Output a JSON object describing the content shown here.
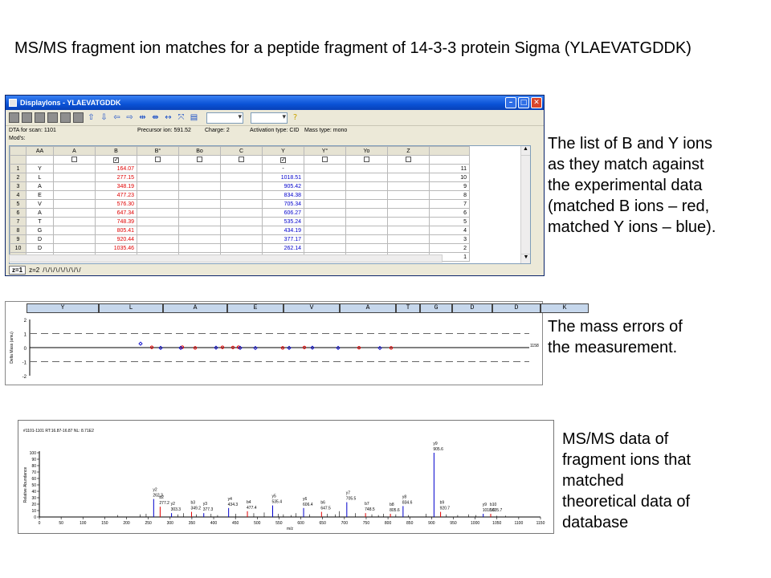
{
  "slide": {
    "title": "MS/MS fragment ion matches for a peptide fragment of 14-3-3 protein Sigma (YLAEVATGDDK)",
    "desc_ions": " The list of B and Y ions\nas they match against\nthe experimental data\n(matched B ions – red,\nmatched Y ions – blue).",
    "desc_errors": "The mass errors of\nthe measurement.",
    "desc_spectrum": "MS/MS data of\nfragment ions that\nmatched\ntheoretical data of\ndatabase"
  },
  "window": {
    "title": "DisplayIons - YLAEVATGDDK",
    "dta": "DTA for scan: 1101",
    "precursor": "Precursor ion: 591.52",
    "charge": "Charge: 2",
    "activation": "Activation type: CID",
    "mass_type": "Mass type: mono",
    "mods": "Mod's:",
    "columns": [
      "AA",
      "A",
      "B",
      "B°",
      "Bo",
      "C",
      "Y",
      "Y°",
      "Yo",
      "Z"
    ],
    "rows": [
      {
        "n": "1",
        "aa": "Y",
        "b": "164.07",
        "y": "-",
        "rn": "11"
      },
      {
        "n": "2",
        "aa": "L",
        "b": "277.15",
        "y": "1018.51",
        "rn": "10"
      },
      {
        "n": "3",
        "aa": "A",
        "b": "348.19",
        "y": "905.42",
        "rn": "9"
      },
      {
        "n": "4",
        "aa": "E",
        "b": "477.23",
        "y": "834.38",
        "rn": "8"
      },
      {
        "n": "5",
        "aa": "V",
        "b": "576.30",
        "y": "705.34",
        "rn": "7"
      },
      {
        "n": "6",
        "aa": "A",
        "b": "647.34",
        "y": "606.27",
        "rn": "6"
      },
      {
        "n": "7",
        "aa": "T",
        "b": "748.39",
        "y": "535.24",
        "rn": "5"
      },
      {
        "n": "8",
        "aa": "G",
        "b": "805.41",
        "y": "434.19",
        "rn": "4"
      },
      {
        "n": "9",
        "aa": "D",
        "b": "920.44",
        "y": "377.17",
        "rn": "3"
      },
      {
        "n": "10",
        "aa": "D",
        "b": "1035.46",
        "y": "262.14",
        "rn": "2"
      },
      {
        "n": "11",
        "aa": "K",
        "b": "-",
        "y": "147.11",
        "rn": "1"
      }
    ],
    "ztab1": "z=1",
    "ztab2": "z=2"
  },
  "chart_data": [
    {
      "type": "scatter",
      "sequence": [
        "Y",
        "L",
        "A",
        "E",
        "V",
        "A",
        "T",
        "G",
        "D",
        "D",
        "K"
      ],
      "ylim": [
        -2,
        2
      ],
      "y_ticks": [
        "2",
        "1",
        "0",
        "-1",
        "-2"
      ],
      "ylabel": "Delta Mass (amu)",
      "b_errors": [
        0.02,
        0.03,
        -0.02,
        0.02,
        0.01,
        0.03,
        -0.02,
        0.01,
        -0.01,
        -0.02
      ],
      "y_errors": [
        0.28,
        -0.02,
        -0.02,
        -0.01,
        -0.02,
        -0.03,
        -0.02,
        -0.01,
        -0.02,
        -0.03
      ],
      "colors": {
        "b": "#e00000",
        "y": "#0000cc"
      },
      "right_label": "1158"
    },
    {
      "type": "bar",
      "header": "#1101-1101 RT:16.87-16.87 NL: 8.71E2",
      "xlabel": "m/z",
      "ylabel": "Relative Abundance",
      "xlim": [
        0,
        1150
      ],
      "ylim": [
        0,
        100
      ],
      "x_ticks": [
        "0",
        "50",
        "100",
        "150",
        "200",
        "250",
        "300",
        "350",
        "400",
        "450",
        "500",
        "550",
        "600",
        "650",
        "700",
        "750",
        "800",
        "850",
        "900",
        "950",
        "1000",
        "1050",
        "1100",
        "1150"
      ],
      "y_ticks": [
        "0",
        "10",
        "20",
        "30",
        "40",
        "50",
        "60",
        "70",
        "80",
        "90",
        "100"
      ],
      "peaks": [
        {
          "mz": 262.3,
          "h": 28,
          "ion": "y2",
          "label": "262.3",
          "s": "y"
        },
        {
          "mz": 277.2,
          "h": 16,
          "ion": "b2",
          "label": "277.2",
          "s": "b"
        },
        {
          "mz": 303.3,
          "h": 6,
          "ion": "y2",
          "label": "303.3",
          "s": "y"
        },
        {
          "mz": 349.2,
          "h": 8,
          "ion": "b3",
          "label": "349.2",
          "s": "b"
        },
        {
          "mz": 377.3,
          "h": 6,
          "ion": "y3",
          "label": "377.3",
          "s": "y"
        },
        {
          "mz": 434.3,
          "h": 14,
          "ion": "y4",
          "label": "434.3",
          "s": "y"
        },
        {
          "mz": 477.4,
          "h": 9,
          "ion": "b4",
          "label": "477.4",
          "s": "b"
        },
        {
          "mz": 535.4,
          "h": 18,
          "ion": "y5",
          "label": "535.4",
          "s": "y"
        },
        {
          "mz": 606.4,
          "h": 14,
          "ion": "y6",
          "label": "606.4",
          "s": "y"
        },
        {
          "mz": 647.5,
          "h": 8,
          "ion": "b6",
          "label": "647.5",
          "s": "b"
        },
        {
          "mz": 705.5,
          "h": 23,
          "ion": "y7",
          "label": "705.5",
          "s": "y"
        },
        {
          "mz": 748.5,
          "h": 6,
          "ion": "b7",
          "label": "748.5",
          "s": "b"
        },
        {
          "mz": 805.6,
          "h": 5,
          "ion": "b8",
          "label": "805.6",
          "s": "b"
        },
        {
          "mz": 834.6,
          "h": 17,
          "ion": "y8",
          "label": "834.6",
          "s": "y"
        },
        {
          "mz": 905.6,
          "h": 100,
          "ion": "y9",
          "label": "905.6",
          "s": "y"
        },
        {
          "mz": 920.7,
          "h": 8,
          "ion": "b9",
          "label": "920.7",
          "s": "b"
        },
        {
          "mz": 1018.6,
          "h": 5,
          "ion": "y9",
          "label": "1018.6",
          "s": "y"
        },
        {
          "mz": 1035.7,
          "h": 5,
          "ion": "b10",
          "label": "1035.7",
          "s": "b"
        }
      ],
      "noise": [
        {
          "mz": 180,
          "h": 3
        },
        {
          "mz": 231,
          "h": 4
        },
        {
          "mz": 245,
          "h": 5
        },
        {
          "mz": 318,
          "h": 4
        },
        {
          "mz": 331,
          "h": 6
        },
        {
          "mz": 360,
          "h": 4
        },
        {
          "mz": 394,
          "h": 5
        },
        {
          "mz": 409,
          "h": 3
        },
        {
          "mz": 451,
          "h": 5
        },
        {
          "mz": 492,
          "h": 6
        },
        {
          "mz": 516,
          "h": 7
        },
        {
          "mz": 548,
          "h": 5
        },
        {
          "mz": 560,
          "h": 4
        },
        {
          "mz": 578,
          "h": 3
        },
        {
          "mz": 589,
          "h": 6
        },
        {
          "mz": 620,
          "h": 4
        },
        {
          "mz": 661,
          "h": 5
        },
        {
          "mz": 679,
          "h": 4
        },
        {
          "mz": 688,
          "h": 9
        },
        {
          "mz": 725,
          "h": 6
        },
        {
          "mz": 763,
          "h": 4
        },
        {
          "mz": 778,
          "h": 3
        },
        {
          "mz": 790,
          "h": 5
        },
        {
          "mz": 818,
          "h": 4
        },
        {
          "mz": 847,
          "h": 3
        },
        {
          "mz": 887,
          "h": 5
        },
        {
          "mz": 934,
          "h": 4
        },
        {
          "mz": 960,
          "h": 3
        },
        {
          "mz": 985,
          "h": 4
        },
        {
          "mz": 1002,
          "h": 3
        },
        {
          "mz": 1050,
          "h": 2
        },
        {
          "mz": 1070,
          "h": 2
        }
      ],
      "colors": {
        "b": "#e00000",
        "y": "#0000cc",
        "noise": "#000000"
      }
    }
  ]
}
